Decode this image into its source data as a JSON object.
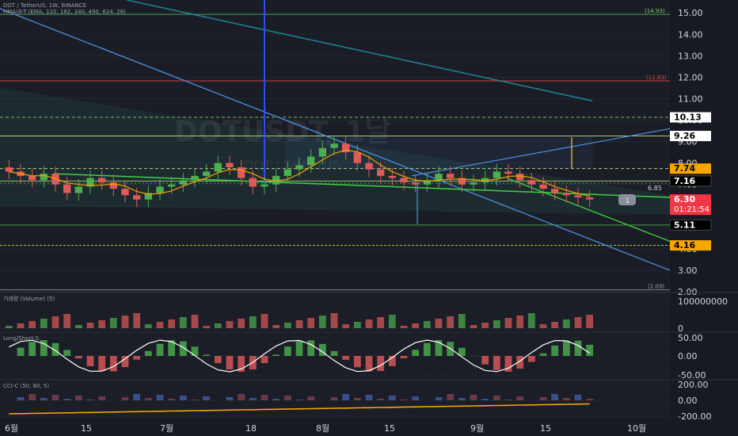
{
  "header": {
    "line1": "DOT / TetherUS, 1W, BINANCE",
    "line2": "HMA(8-T (EMA, 120, 182, 240, 490, 624, 26)"
  },
  "watermark": {
    "symbol": "DOTUSDT, 1날",
    "sub": "DOT / TetherUS"
  },
  "colors": {
    "background": "#171a22",
    "up": "#4caf50",
    "down": "#e05a5a",
    "axis_text": "#d1d4dc",
    "label_orange": "#f7a600",
    "label_red": "#f23645",
    "label_white": "#ffffff",
    "label_black": "#000000"
  },
  "price_axis": {
    "ticks": [
      "15.00",
      "14.00",
      "13.00",
      "12.00",
      "11.00",
      "10.00",
      "9.00",
      "8.00",
      "7.00",
      "6.00",
      "5.00",
      "4.00",
      "3.00",
      "2.00"
    ],
    "labels": [
      {
        "text": "10.13",
        "style": "white"
      },
      {
        "text": "9.26",
        "style": "white"
      },
      {
        "text": "7.74",
        "style": "orange"
      },
      {
        "text": "7.16",
        "style": "black"
      },
      {
        "text": "6.30",
        "style": "red",
        "sub": "01:21:54"
      },
      {
        "text": "5.11",
        "style": "black"
      },
      {
        "text": "4.16",
        "style": "orange"
      }
    ],
    "small_labels": [
      "(14.93)",
      "(11.83)",
      "(2.09)",
      "6.85"
    ],
    "flag": "1"
  },
  "time_axis": {
    "labels": [
      "6월",
      "15",
      "7월",
      "18",
      "8월",
      "15",
      "9월",
      "15",
      "10월"
    ]
  },
  "panes": {
    "volume": {
      "title": "거래량 (Volume) (5)",
      "ticks": [
        "100000000",
        "0"
      ]
    },
    "long_short": {
      "title": "Long/Short-S",
      "ticks": [
        "50.00",
        "0.00",
        "-50.00"
      ]
    },
    "cci": {
      "title": "CCI-C (50, 60, 5)",
      "ticks": [
        "200.00",
        "0.00",
        "-200.00"
      ]
    }
  },
  "chart_data": {
    "type": "candlestick",
    "symbol": "DOT / TetherUS",
    "interval": "1W",
    "x": [
      "6월",
      "15",
      "7월",
      "18",
      "8월",
      "15",
      "9월",
      "15",
      "10월"
    ],
    "ylim": [
      2.0,
      15.6
    ],
    "close_series": [
      7.6,
      7.4,
      7.2,
      7.5,
      7.0,
      6.6,
      6.9,
      7.3,
      7.1,
      6.8,
      6.5,
      6.3,
      6.6,
      6.9,
      7.0,
      7.2,
      7.4,
      7.6,
      8.0,
      7.8,
      7.3,
      6.9,
      7.0,
      7.4,
      7.7,
      7.9,
      8.3,
      8.7,
      8.9,
      8.5,
      8.0,
      7.7,
      7.4,
      7.3,
      7.1,
      7.0,
      7.2,
      7.5,
      7.3,
      7.0,
      7.1,
      7.3,
      7.6,
      7.5,
      7.2,
      7.0,
      6.8,
      6.6,
      6.5,
      6.4,
      6.3
    ],
    "levels": [
      14.93,
      11.83,
      10.13,
      9.26,
      7.74,
      7.16,
      6.85,
      6.3,
      5.11,
      4.16,
      2.09
    ],
    "last_price": 6.3,
    "countdown": "01:21:54"
  }
}
